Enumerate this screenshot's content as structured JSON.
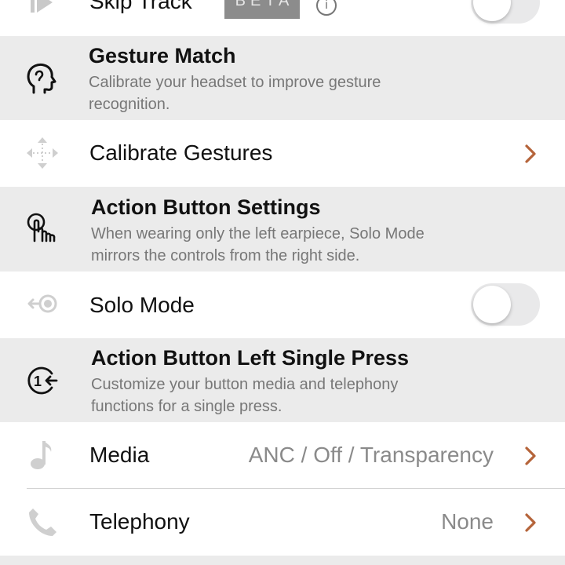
{
  "skip_track": {
    "label": "Skip Track",
    "badge": "BETA",
    "info_glyph": "i",
    "icon": "skip-forward-icon",
    "toggle_on": false
  },
  "gesture_match": {
    "title": "Gesture Match",
    "description": "Calibrate your headset to improve gesture recognition.",
    "icon": "head-profile-icon"
  },
  "calibrate_gestures": {
    "label": "Calibrate Gestures",
    "icon": "move-arrows-icon"
  },
  "action_button_settings": {
    "title": "Action Button Settings",
    "description": "When wearing only the left earpiece, Solo Mode mirrors the controls from the right side.",
    "icon": "tap-hand-icon"
  },
  "solo_mode": {
    "label": "Solo Mode",
    "icon": "earbud-icon",
    "toggle_on": false
  },
  "left_single_press": {
    "title": "Action Button Left Single Press",
    "description": "Customize your button media and telephony functions for a single press.",
    "icon": "single-press-icon",
    "glyph": "1"
  },
  "media": {
    "label": "Media",
    "value": "ANC / Off / Transparency",
    "icon": "music-note-icon"
  },
  "telephony": {
    "label": "Telephony",
    "value": "None",
    "icon": "phone-icon"
  },
  "colors": {
    "accent_chevron": "#b5643a",
    "section_bg": "#ebebeb",
    "secondary_text": "#777777"
  }
}
